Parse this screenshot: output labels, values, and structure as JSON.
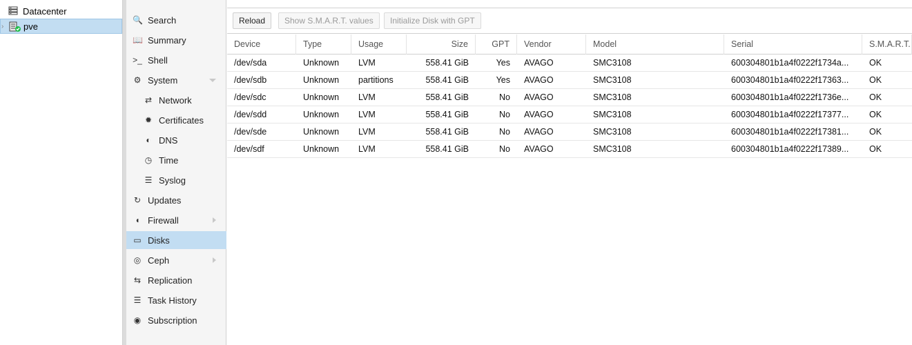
{
  "tree": {
    "datacenter_label": "Datacenter",
    "node_label": "pve"
  },
  "nav": [
    {
      "label": "Search",
      "icon": "search-icon",
      "glyph": "🔍"
    },
    {
      "label": "Summary",
      "icon": "book-icon",
      "glyph": "📖"
    },
    {
      "label": "Shell",
      "icon": "terminal-icon",
      "glyph": ">_"
    },
    {
      "label": "System",
      "icon": "gears-icon",
      "glyph": "⚙"
    },
    {
      "label": "Network",
      "icon": "exchange-icon",
      "glyph": "⇄"
    },
    {
      "label": "Certificates",
      "icon": "certificate-icon",
      "glyph": "✹"
    },
    {
      "label": "DNS",
      "icon": "globe-icon",
      "glyph": "◐"
    },
    {
      "label": "Time",
      "icon": "clock-icon",
      "glyph": "◷"
    },
    {
      "label": "Syslog",
      "icon": "list-icon",
      "glyph": "☰"
    },
    {
      "label": "Updates",
      "icon": "refresh-icon",
      "glyph": "↻"
    },
    {
      "label": "Firewall",
      "icon": "shield-icon",
      "glyph": "◖"
    },
    {
      "label": "Disks",
      "icon": "hdd-icon",
      "glyph": "▭"
    },
    {
      "label": "Ceph",
      "icon": "ceph-icon",
      "glyph": "◎"
    },
    {
      "label": "Replication",
      "icon": "retweet-icon",
      "glyph": "⇆"
    },
    {
      "label": "Task History",
      "icon": "list-alt-icon",
      "glyph": "☰"
    },
    {
      "label": "Subscription",
      "icon": "support-icon",
      "glyph": "◉"
    }
  ],
  "toolbar": {
    "reload_label": "Reload",
    "smart_label": "Show S.M.A.R.T. values",
    "init_gpt_label": "Initialize Disk with GPT"
  },
  "table": {
    "headers": [
      "Device",
      "Type",
      "Usage",
      "Size",
      "GPT",
      "Vendor",
      "Model",
      "Serial",
      "S.M.A.R.T."
    ],
    "rows": [
      [
        "/dev/sda",
        "Unknown",
        "LVM",
        "558.41 GiB",
        "Yes",
        "AVAGO",
        "SMC3108",
        "600304801b1a4f0222f1734a...",
        "OK"
      ],
      [
        "/dev/sdb",
        "Unknown",
        "partitions",
        "558.41 GiB",
        "Yes",
        "AVAGO",
        "SMC3108",
        "600304801b1a4f0222f17363...",
        "OK"
      ],
      [
        "/dev/sdc",
        "Unknown",
        "LVM",
        "558.41 GiB",
        "No",
        "AVAGO",
        "SMC3108",
        "600304801b1a4f0222f1736e...",
        "OK"
      ],
      [
        "/dev/sdd",
        "Unknown",
        "LVM",
        "558.41 GiB",
        "No",
        "AVAGO",
        "SMC3108",
        "600304801b1a4f0222f17377...",
        "OK"
      ],
      [
        "/dev/sde",
        "Unknown",
        "LVM",
        "558.41 GiB",
        "No",
        "AVAGO",
        "SMC3108",
        "600304801b1a4f0222f17381...",
        "OK"
      ],
      [
        "/dev/sdf",
        "Unknown",
        "LVM",
        "558.41 GiB",
        "No",
        "AVAGO",
        "SMC3108",
        "600304801b1a4f0222f17389...",
        "OK"
      ]
    ]
  },
  "colors": {
    "selection": "#c2ddf2",
    "status_ok": "#21bf4b"
  }
}
